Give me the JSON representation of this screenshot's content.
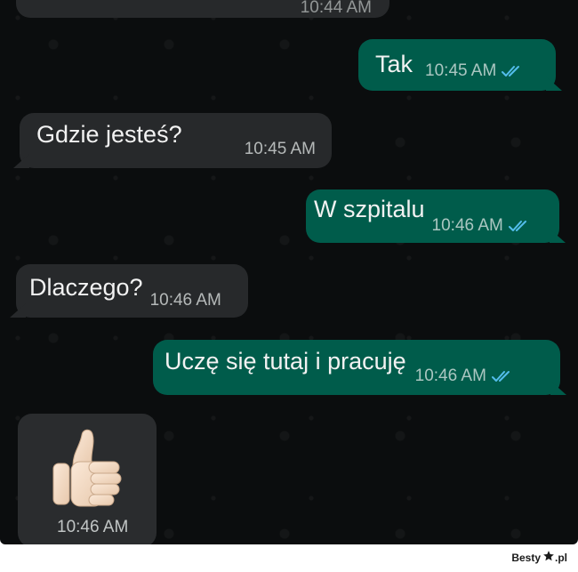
{
  "chat": {
    "previous_message": {
      "time": "10:44 AM"
    },
    "messages": [
      {
        "id": "m1",
        "direction": "outgoing",
        "text": "Tak",
        "time": "10:45 AM",
        "status": "read"
      },
      {
        "id": "m2",
        "direction": "incoming",
        "text": "Gdzie jesteś?",
        "time": "10:45 AM"
      },
      {
        "id": "m3",
        "direction": "outgoing",
        "text": "W szpitalu",
        "time": "10:46 AM",
        "status": "read"
      },
      {
        "id": "m4",
        "direction": "incoming",
        "text": "Dlaczego?",
        "time": "10:46 AM"
      },
      {
        "id": "m5",
        "direction": "outgoing",
        "text": "Uczę się tutaj i pracuję",
        "time": "10:46 AM",
        "status": "read"
      },
      {
        "id": "m6",
        "direction": "incoming",
        "type": "sticker",
        "sticker": "thumbs-up",
        "time": "10:46 AM"
      }
    ]
  },
  "watermark": {
    "text": "Besty",
    "suffix": ".pl"
  },
  "colors": {
    "background": "#0b0d0e",
    "outgoing_bubble": "#005c4b",
    "incoming_bubble": "#27292b",
    "read_ticks": "#53bdeb"
  }
}
